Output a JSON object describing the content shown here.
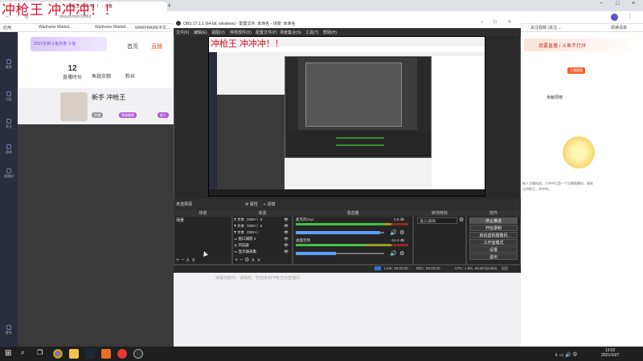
{
  "overlay_title": "冲枪王 冲冲冲！！",
  "chrome": {
    "active_tab": "冲枪王 冲冲冲！！ - 斗鱼",
    "new_tab": "+",
    "url": "douyu.com/11863",
    "bookmarks": [
      "应用",
      "Warframe Market...",
      "Warframe Market...",
      "WARFRAME中文...",
      "关注视频 (关注 ...",
      "阅读清单"
    ],
    "window_controls": [
      "−",
      "□",
      "×"
    ]
  },
  "site": {
    "logo_text": "2022全新斗鱼年度 斗鱼",
    "nav": [
      "首页",
      "直播"
    ],
    "side_items": [
      "推荐",
      "分区",
      "关注",
      "游戏",
      "直播间",
      "更多"
    ],
    "stats": [
      {
        "value": "12",
        "label": "直播时长"
      },
      {
        "value": "",
        "label": "鱼翅余额"
      },
      {
        "value": "",
        "label": "粉丝"
      }
    ],
    "streamer_name": "新手 冲枪王",
    "badges": [
      "主播",
      "等级徽章",
      "新人"
    ],
    "right_ad": "我要直播 / 斗鱼不打烊",
    "right_rank": "贡献周榜",
    "right_btn": "开播提醒",
    "right_text": "新人主播欢迎，小冲冲又是一个主播直播间，请关注冲枪王，冲冲冲。"
  },
  "obs": {
    "title": "OBS 27.1.1 (64-bit, windows) - 配置文件: 未命名 - 场景: 未命名",
    "menu": [
      "文件(F)",
      "编辑(E)",
      "视图(V)",
      "停靠部件(D)",
      "配置文件(P)",
      "场景集合(S)",
      "工具(T)",
      "帮助(H)"
    ],
    "preview_title": "冲枪王 冲冲冲！！",
    "scene_label": "未选择源",
    "props_btn": "属性",
    "filters_btn": "滤镜",
    "docks": {
      "scenes": "场景",
      "sources": "来源",
      "mixer": "混音器",
      "transitions": "转场特效",
      "controls": "控件"
    },
    "scene_items": [
      "场景"
    ],
    "sources": [
      "文本（GDI+）3",
      "文本（GDI+）2",
      "文本（GDI+）",
      "窗口捕获 2",
      "浏览器",
      "显示器采集"
    ],
    "mixer": [
      {
        "name": "麦克风/Aux",
        "db": "0.0 dB",
        "level": 0.78
      },
      {
        "name": "桌面音频",
        "db": "-14.4 dB",
        "level": 0.62
      }
    ],
    "transition": "淡入淡出",
    "controls": [
      "停止推流",
      "开始录制",
      "启动虚拟摄像机",
      "工作室模式",
      "设置",
      "退出"
    ],
    "status": {
      "live": "LIVE: 00:00:00",
      "rec": "REC: 00:00:00",
      "cpu": "CPU: 1.9%, 60.00 fps",
      "kbps": "kb/s"
    }
  },
  "below_text": "弹幕加载中，请稍候，欢迎来到冲枪王的直播间",
  "taskbar": {
    "time": "13:02",
    "date": "2021/10/7"
  }
}
